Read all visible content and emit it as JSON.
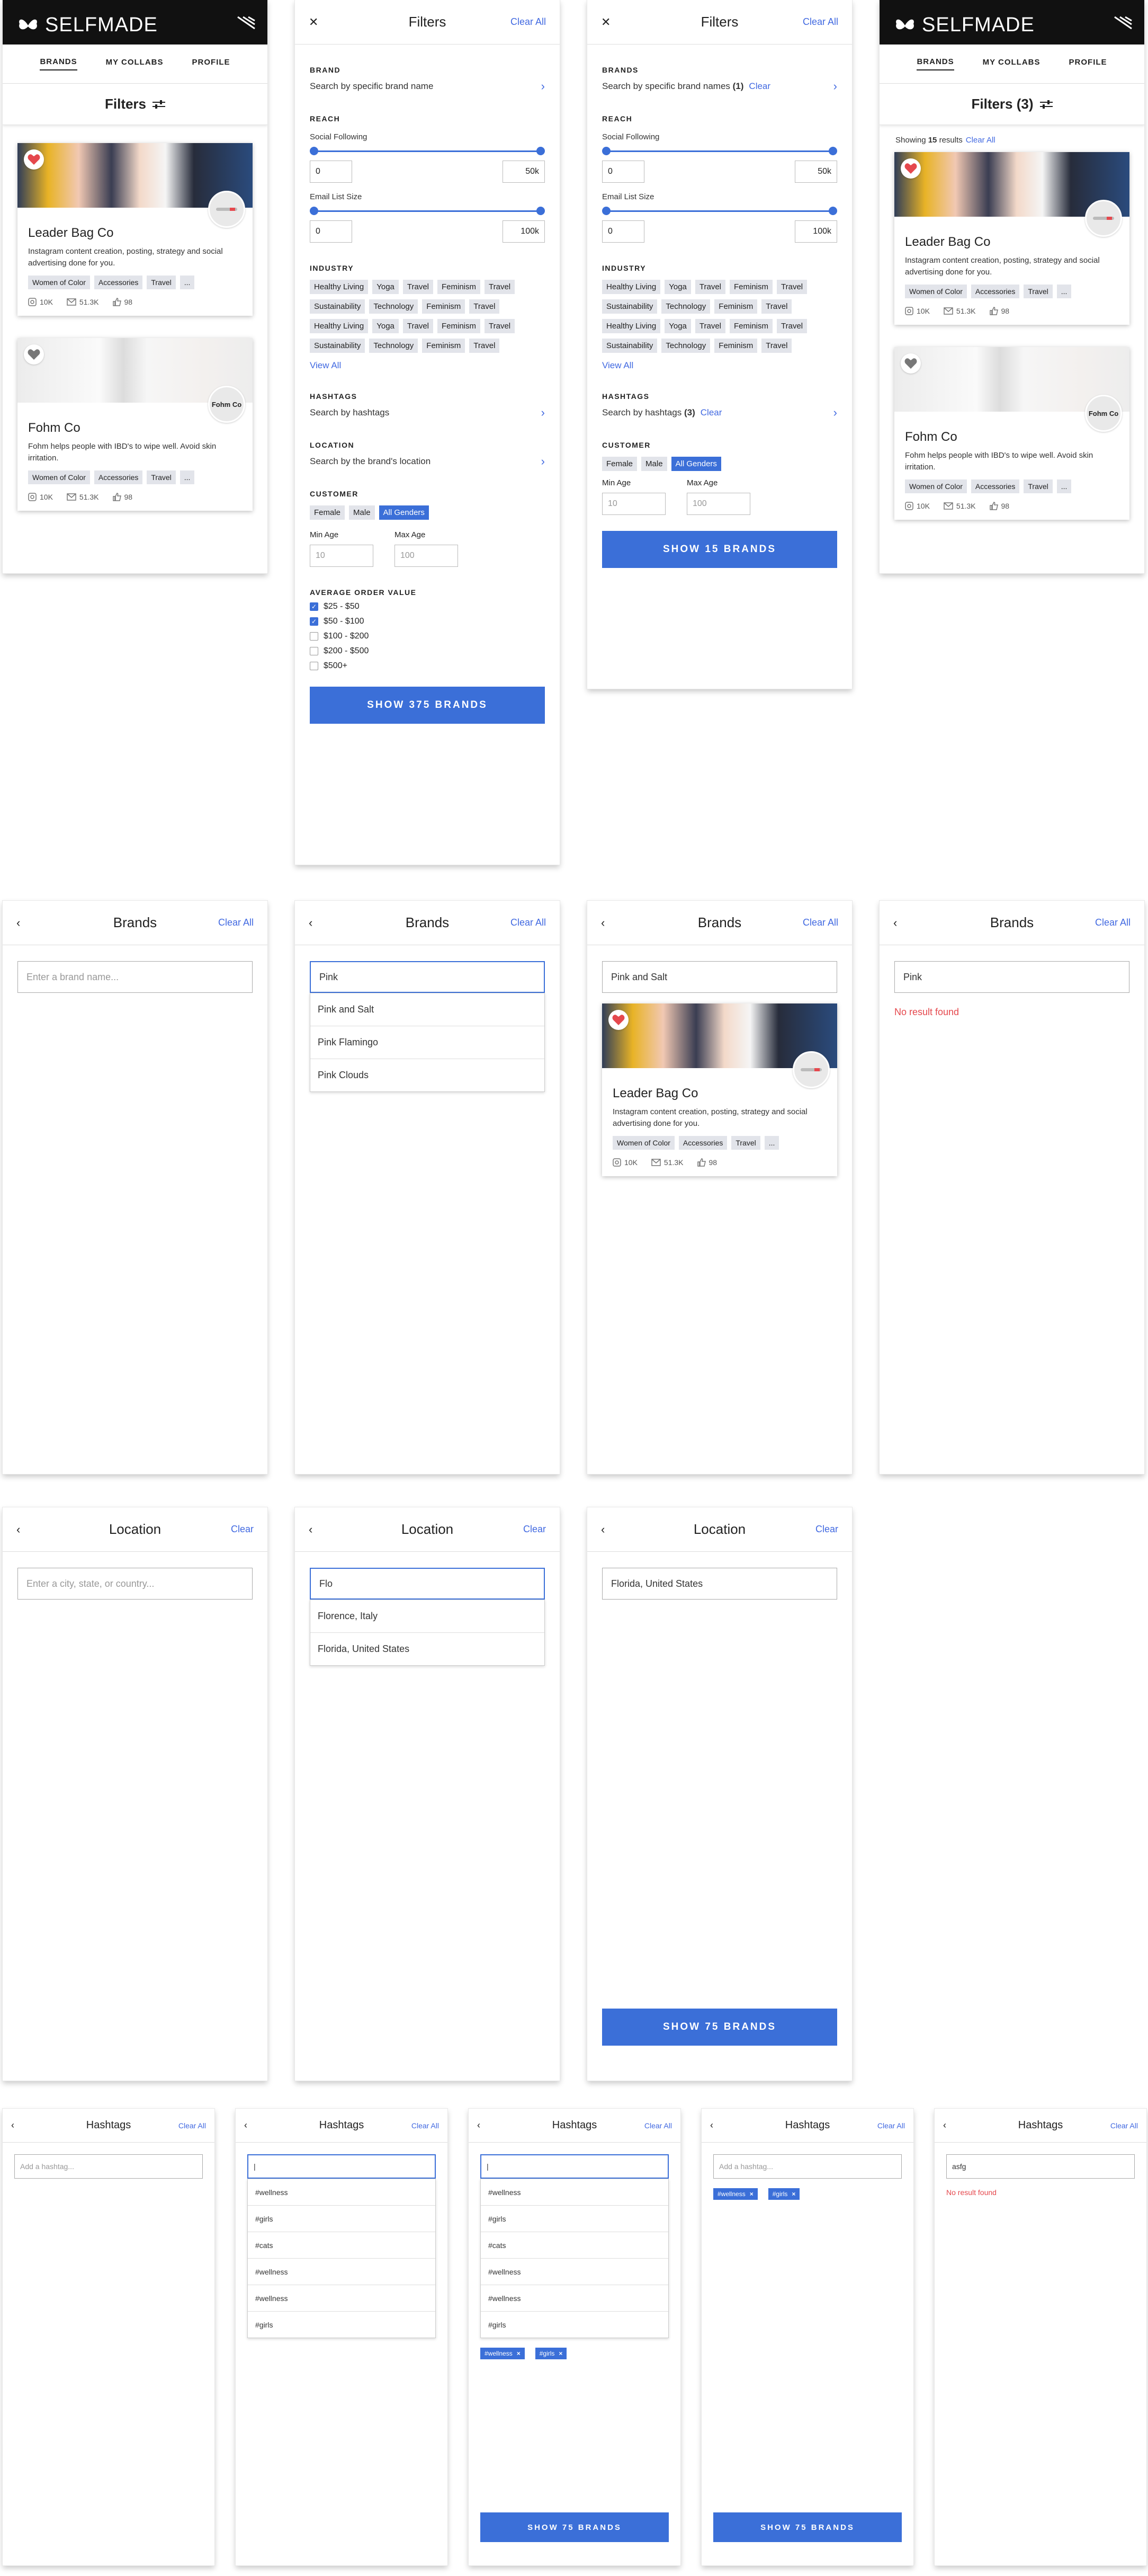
{
  "brand": {
    "logo": "SELFMADE"
  },
  "nav": {
    "brands": "BRANDS",
    "collabs": "MY COLLABS",
    "profile": "PROFILE"
  },
  "feed": {
    "filters": "Filters",
    "filters_count": "Filters (3)",
    "showing_pre": "Showing ",
    "showing_num": "15",
    "showing_post": " results",
    "clear_all": "Clear All"
  },
  "cards": [
    {
      "name": "Leader Bag Co",
      "desc": "Instagram content creation, posting, strategy and social advertising done for you.",
      "tags": [
        "Women of Color",
        "Accessories",
        "Travel",
        "..."
      ],
      "followers": "10K",
      "email": "51.3K",
      "likes": "98",
      "liked": true
    },
    {
      "name": "Fohm Co",
      "logo": "Fohm Co",
      "desc": "Fohm helps people with IBD's to wipe well. Avoid skin irritation.",
      "tags": [
        "Women of Color",
        "Accessories",
        "Travel",
        "..."
      ],
      "followers": "10K",
      "email": "51.3K",
      "likes": "98",
      "liked": false
    }
  ],
  "filters": {
    "title": "Filters",
    "clear_all": "Clear All",
    "brand_h": "BRAND",
    "brands_h": "BRANDS",
    "brand_txt": "Search by specific brand name",
    "brand_txt2": "Search by specific brand names",
    "brand_count": "(1)",
    "clear": "Clear",
    "reach_h": "REACH",
    "social": "Social Following",
    "email": "Email List Size",
    "min": "0",
    "soc_max": "50k",
    "email_max": "100k",
    "industry_h": "INDUSTRY",
    "industry": [
      "Healthy Living",
      "Yoga",
      "Travel",
      "Feminism",
      "Travel",
      "Sustainability",
      "Technology",
      "Feminism",
      "Travel",
      "Healthy Living",
      "Yoga",
      "Travel",
      "Feminism",
      "Travel",
      "Sustainability",
      "Technology",
      "Feminism",
      "Travel"
    ],
    "view_all": "View All",
    "hashtags_h": "HASHTAGS",
    "hashtags_txt": "Search by hashtags",
    "hashtags_count": "(3)",
    "location_h": "LOCATION",
    "location_txt": "Search by the brand's location",
    "customer_h": "CUSTOMER",
    "genders": [
      "Female",
      "Male",
      "All Genders"
    ],
    "min_age": "Min Age",
    "max_age": "Max Age",
    "min_age_ph": "10",
    "max_age_ph": "100",
    "aov_h": "AVERAGE ORDER VALUE",
    "aov": [
      {
        "label": "$25 - $50",
        "on": true
      },
      {
        "label": "$50 - $100",
        "on": true
      },
      {
        "label": "$100 - $200",
        "on": false
      },
      {
        "label": "$200 - $500",
        "on": false
      },
      {
        "label": "$500+",
        "on": false
      }
    ],
    "show375": "SHOW 375 BRANDS",
    "show15": "SHOW 15 BRANDS"
  },
  "brands_screen": {
    "title": "Brands",
    "clear_all": "Clear All",
    "placeholder": "Enter a brand name...",
    "query": "Pink",
    "results": [
      "Pink and Salt",
      "Pink Flamingo",
      "Pink Clouds"
    ],
    "selected": "Pink and Salt",
    "no_result": "No result found"
  },
  "location_screen": {
    "title": "Location",
    "clear": "Clear",
    "placeholder": "Enter a city, state, or country...",
    "query": "Flo",
    "results": [
      "Florence, Italy",
      "Florida, United States"
    ],
    "selected": "Florida, United States",
    "show": "SHOW 75 BRANDS"
  },
  "hashtag_screen": {
    "title": "Hashtags",
    "clear_all": "Clear All",
    "placeholder": "Add a hashtag...",
    "results": [
      "#wellness",
      "#girls",
      "#cats",
      "#wellness",
      "#wellness",
      "#girls"
    ],
    "chips": [
      "#wellness",
      "#girls"
    ],
    "query_bad": "asfg",
    "no_result": "No result found",
    "show": "SHOW 75 BRANDS"
  },
  "colors": {
    "accent": "#3b6fd8",
    "dark": "#111111",
    "error": "#e5484d"
  }
}
